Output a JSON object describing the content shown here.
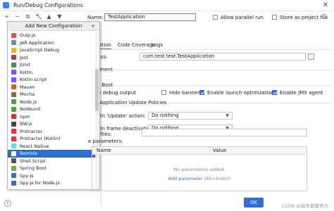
{
  "window": {
    "title": "Run/Debug Configurations",
    "close_glyph": "✕"
  },
  "toolbar": {
    "buttons": [
      {
        "glyph": "+",
        "name": "add-icon"
      },
      {
        "glyph": "−",
        "name": "remove-icon"
      },
      {
        "glyph": "⧉",
        "name": "copy-icon"
      },
      {
        "glyph": "🔧",
        "name": "wrench-icon"
      },
      {
        "glyph": "▲",
        "name": "move-up-icon"
      },
      {
        "glyph": "▼",
        "name": "move-down-icon"
      }
    ]
  },
  "popup": {
    "title": "Add New Configuration",
    "menu_glyph": "÷",
    "items": [
      {
        "label": "Gulp.js",
        "color": "#d9534f"
      },
      {
        "label": "JAR Application",
        "color": "#6b8bbd"
      },
      {
        "label": "JavaScript Debug",
        "color": "#e6b422"
      },
      {
        "label": "Jest",
        "color": "#99425b"
      },
      {
        "label": "JUnit",
        "color": "#3f9b49"
      },
      {
        "label": "Kotlin",
        "color": "#7f52ff"
      },
      {
        "label": "Kotlin script",
        "color": "#7f52ff"
      },
      {
        "label": "Maven",
        "color": "#c36a2d"
      },
      {
        "label": "Mocha",
        "color": "#8d6748"
      },
      {
        "label": "Node.js",
        "color": "#539e43"
      },
      {
        "label": "Nodeunit",
        "color": "#539e43"
      },
      {
        "label": "npm",
        "color": "#cb3837"
      },
      {
        "label": "NW.js",
        "color": "#444444"
      },
      {
        "label": "Protractor",
        "color": "#e23237"
      },
      {
        "label": "Protractor (Kotlin)",
        "color": "#e23237"
      },
      {
        "label": "React Native",
        "color": "#61dafb"
      },
      {
        "label": "Remote",
        "color": "#ffffff",
        "selected": true
      },
      {
        "label": "Shell Script",
        "color": "#555555"
      },
      {
        "label": "Spring Boot",
        "color": "#6db33f"
      },
      {
        "label": "Spy-js",
        "color": "#3b6fb6"
      },
      {
        "label": "Spy-js for Node.js",
        "color": "#3b6fb6"
      }
    ]
  },
  "form": {
    "name_label": "Name:",
    "name_value": "TestApplication",
    "allow_parallel_label": "Allow parallel run",
    "allow_parallel_checked": false,
    "store_as_file_label": "Store as project file",
    "store_as_file_checked": false,
    "tabs": [
      "figuration",
      "Code Coverage",
      "Logs"
    ],
    "main_class_label": "class:",
    "main_class_value": "com.test.test.TestApplication",
    "environment_label": "vironment",
    "spring_boot_label": "pring Boot",
    "enable_debug_label": "nable debug output",
    "enable_debug_checked": false,
    "hide_banner_label": "Hide banner",
    "hide_banner_checked": false,
    "launch_opt_label": "Enable launch optimization",
    "launch_opt_checked": true,
    "jmx_label": "Enable JMX agent",
    "jmx_checked": true,
    "update_policies_label": "ning Application Update Policies",
    "on_update_label": "On 'Update' action:",
    "on_update_value": "Do nothing",
    "on_frame_label": "On frame deactivation:",
    "on_frame_value": "Do nothing",
    "profiles_label": "e profiles:",
    "params_label": "e parameters:"
  },
  "table": {
    "headers": [
      "Name",
      "Value"
    ],
    "empty_message": "No parameters added.",
    "add_link": "Add parameter",
    "add_hint": "(Alt+Insert)"
  },
  "footer": {
    "help_glyph": "?",
    "ok_label": "OK",
    "watermark": "CSDN @每天都要努力"
  }
}
